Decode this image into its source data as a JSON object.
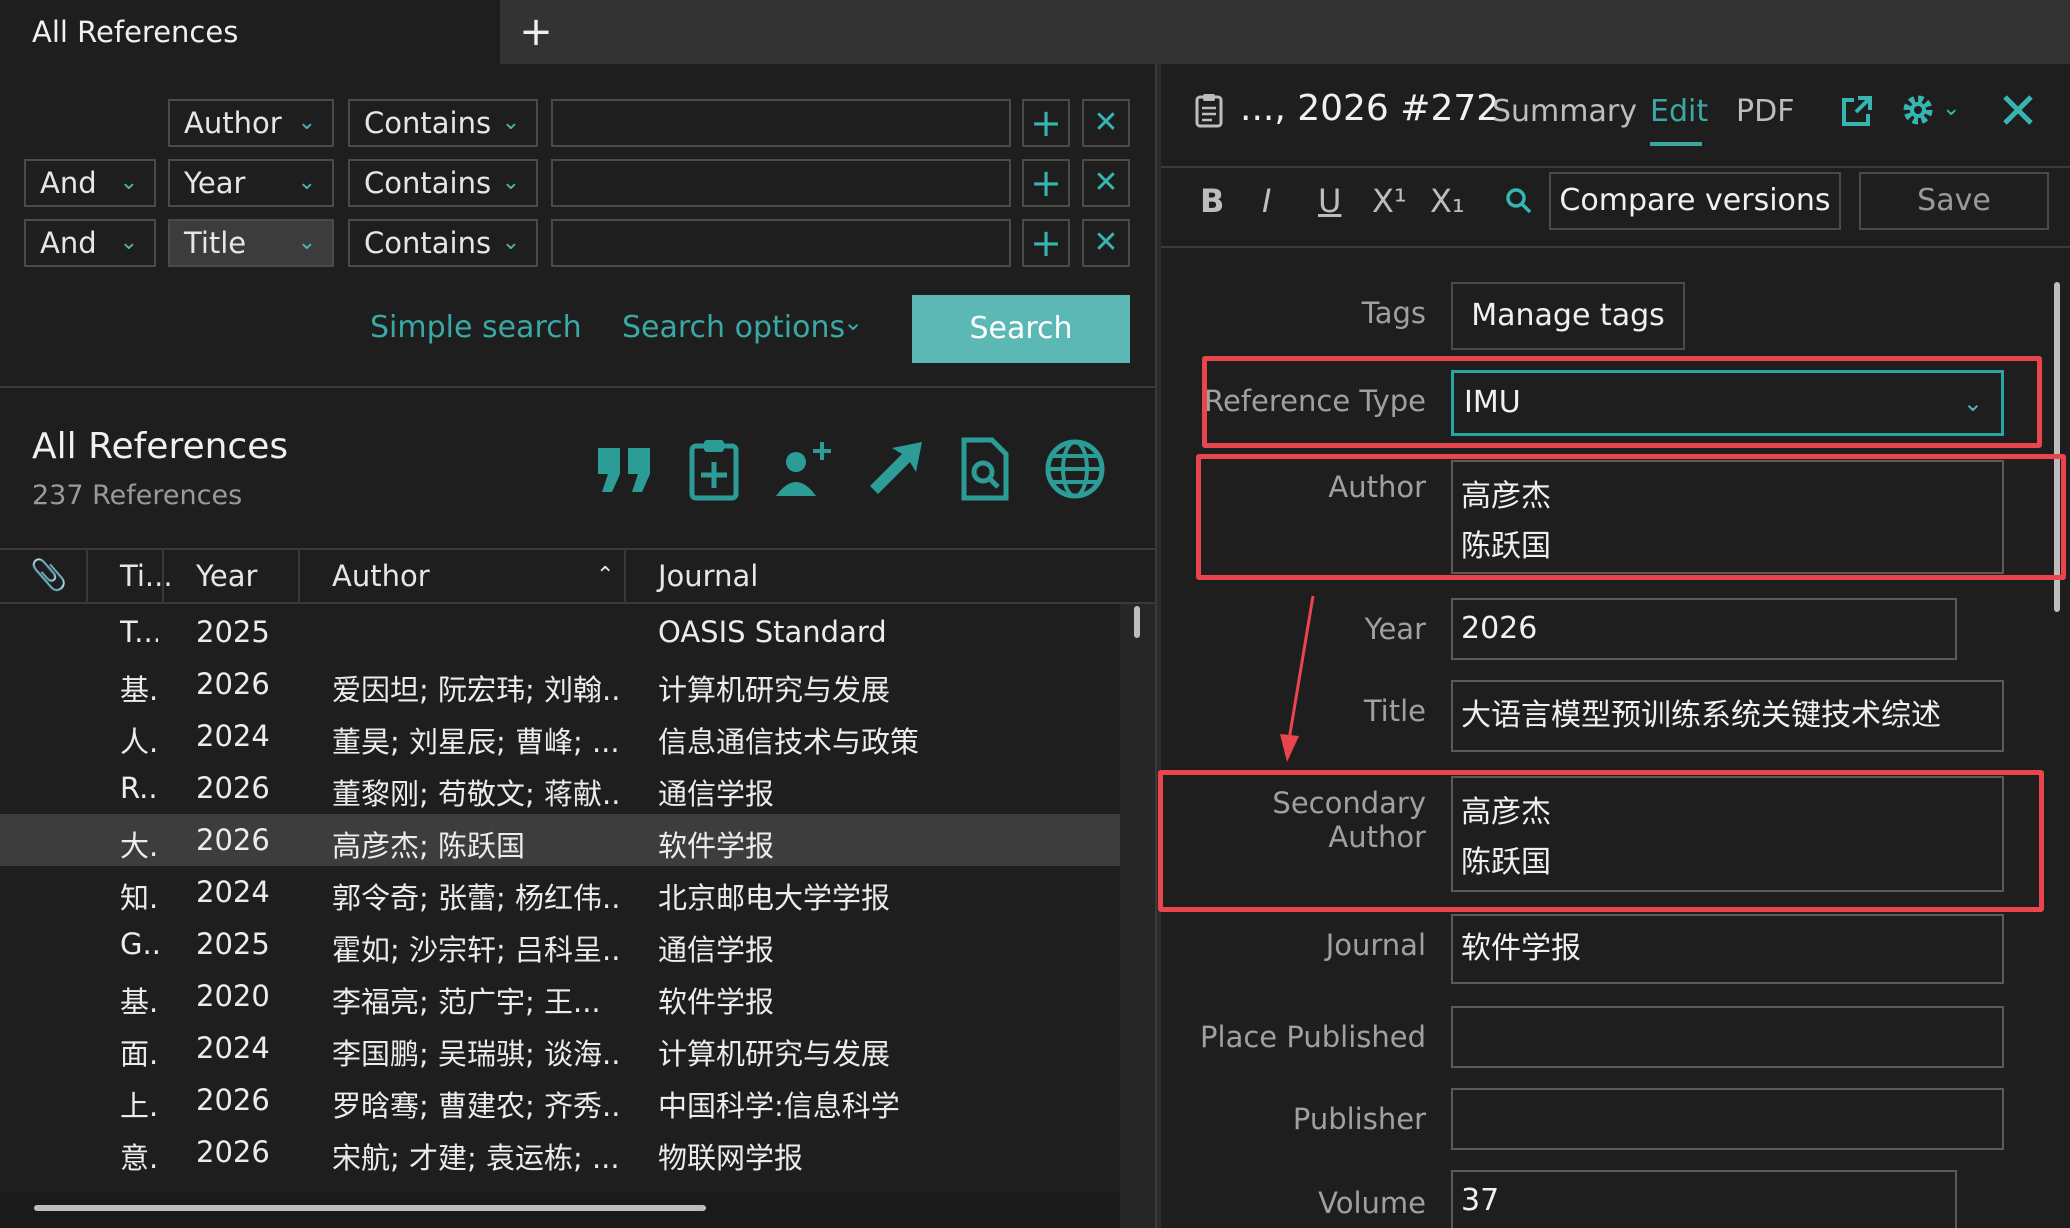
{
  "tabs": {
    "active_label": "All References",
    "add_label": "+"
  },
  "search": {
    "rows": [
      {
        "bool": "",
        "field": "Author",
        "op": "Contains",
        "value": ""
      },
      {
        "bool": "And",
        "field": "Year",
        "op": "Contains",
        "value": ""
      },
      {
        "bool": "And",
        "field": "Title",
        "op": "Contains",
        "value": ""
      }
    ],
    "add_symbol": "+",
    "remove_symbol": "✕",
    "simple_search_label": "Simple search",
    "search_options_label": "Search options",
    "search_button_label": "Search"
  },
  "library": {
    "title": "All References",
    "count": "237 References",
    "toolbar_icons": [
      "quote-icon",
      "clipboard-add-icon",
      "add-user-icon",
      "export-arrow-icon",
      "find-document-icon",
      "globe-icon"
    ]
  },
  "table": {
    "columns": [
      "Ti...",
      "Year",
      "Author",
      "Journal"
    ],
    "rows": [
      {
        "title": "T...",
        "year": "2025",
        "author": "",
        "journal": "OASIS Standard"
      },
      {
        "title": "基.",
        "year": "2026",
        "author": "爱因坦; 阮宏玮; 刘翰...",
        "journal": "计算机研究与发展"
      },
      {
        "title": "人.",
        "year": "2024",
        "author": "董昊; 刘星辰; 曹峰; ...",
        "journal": "信息通信技术与政策"
      },
      {
        "title": "R...",
        "year": "2026",
        "author": "董黎刚; 苟敬文; 蒋献...",
        "journal": "通信学报"
      },
      {
        "title": "大.",
        "year": "2026",
        "author": "高彦杰; 陈跃国",
        "journal": "软件学报"
      },
      {
        "title": "知.",
        "year": "2024",
        "author": "郭令奇; 张蕾; 杨红伟...",
        "journal": "北京邮电大学学报"
      },
      {
        "title": "G...",
        "year": "2025",
        "author": "霍如; 沙宗轩; 吕科呈...",
        "journal": "通信学报"
      },
      {
        "title": "基.",
        "year": "2020",
        "author": "李福亮; 范广宇; 王...",
        "journal": "软件学报"
      },
      {
        "title": "面.",
        "year": "2024",
        "author": "李国鹏; 吴瑞骐; 谈海...",
        "journal": "计算机研究与发展"
      },
      {
        "title": "上.",
        "year": "2026",
        "author": "罗晗骞; 曹建农; 齐秀...",
        "journal": "中国科学:信息科学"
      },
      {
        "title": "意.",
        "year": "2026",
        "author": "宋航; 才建; 袁运栋; ...",
        "journal": "物联网学报"
      }
    ],
    "selected_index": 4
  },
  "detail": {
    "title": "..., 2026 #272",
    "tabs": [
      "Summary",
      "Edit",
      "PDF"
    ],
    "active_tab": "Edit",
    "format_buttons": [
      "B",
      "I",
      "U",
      "X¹",
      "X₁"
    ],
    "compare_label": "Compare versions",
    "save_label": "Save",
    "fields": {
      "tags_label": "Tags",
      "manage_tags_label": "Manage tags",
      "reference_type_label": "Reference Type",
      "reference_type_value": "IMU",
      "author_label": "Author",
      "author_lines": [
        "高彦杰",
        "陈跃国"
      ],
      "year_label": "Year",
      "year_value": "2026",
      "title_label": "Title",
      "title_value": "大语言模型预训练系统关键技术综述",
      "secondary_author_label": "Secondary Author",
      "secondary_author_lines": [
        "高彦杰",
        "陈跃国"
      ],
      "journal_label": "Journal",
      "journal_value": "软件学报",
      "place_published_label": "Place Published",
      "place_published_value": "",
      "publisher_label": "Publisher",
      "publisher_value": "",
      "volume_label": "Volume",
      "volume_value": "37"
    }
  },
  "colors": {
    "accent": "#3aa8a4",
    "search_button": "#5cb8b4",
    "highlight_box": "#e8454f",
    "background": "#1e1e1e"
  }
}
